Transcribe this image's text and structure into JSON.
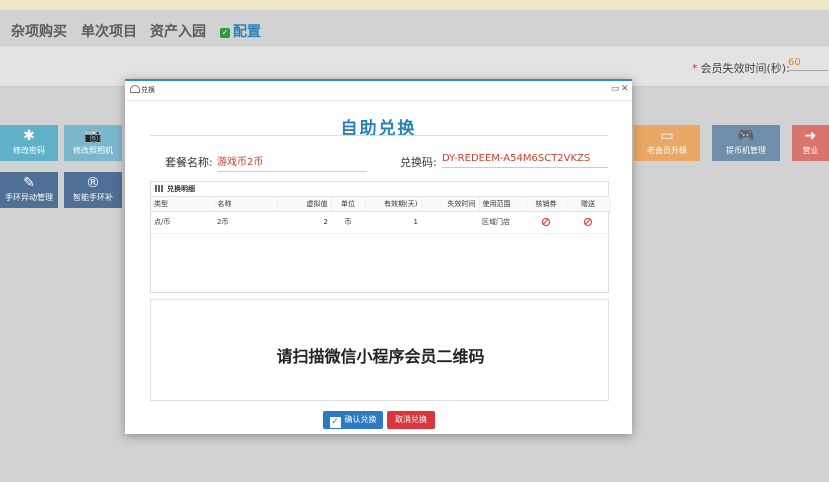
{
  "tabs": [
    {
      "label": "杂项购买"
    },
    {
      "label": "单次项目"
    },
    {
      "label": "资产入园"
    },
    {
      "label": "配置",
      "active": true
    }
  ],
  "settings": {
    "member_timeout_label": "会员失效时间(秒):",
    "member_timeout_value": "60"
  },
  "tiles": {
    "change_password": {
      "icon": "✱",
      "label": "修改密码"
    },
    "change_photo": {
      "icon": "📷",
      "label": "修改照相机"
    },
    "member_upgrade": {
      "icon": "▭",
      "label": "老会员升级"
    },
    "coin_machine": {
      "icon": "🎮",
      "label": "提币机管理"
    },
    "business": {
      "icon": "➜",
      "label": "营业"
    },
    "wristband_change": {
      "icon": "✎",
      "label": "手环异动管理"
    },
    "smart_wristband": {
      "icon": "®",
      "label": "智能手环补"
    }
  },
  "modal": {
    "header_title": "兑换",
    "title": "自助兑换",
    "package_label": "套餐名称:",
    "package_value": "游戏币2币",
    "code_label": "兑换码:",
    "code_value": "DY-REDEEM-A54M6SCT2VKZS",
    "detail_title": "兑换明细",
    "columns": [
      "类型",
      "名称",
      "虚拟值",
      "单位",
      "有效期(天)",
      "失效时间",
      "使用范围",
      "核销券",
      "赠送"
    ],
    "rows": [
      {
        "type": "点/币",
        "name": "2币",
        "virtual": "2",
        "unit": "币",
        "valid_days": "1",
        "expire": "",
        "scope": "区域门店"
      }
    ],
    "scan_prompt": "请扫描微信小程序会员二维码",
    "confirm_label": "确认兑换",
    "cancel_label": "取消兑换"
  },
  "colors": {
    "accent": "#2a82b8",
    "confirm": "#2f79c2",
    "cancel": "#d9363e",
    "value_text": "#c8412f"
  }
}
